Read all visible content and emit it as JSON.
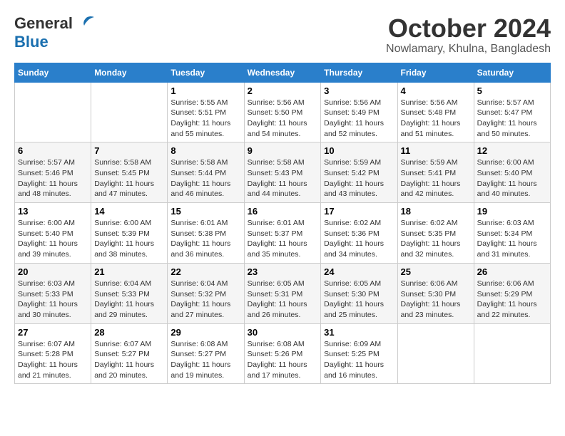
{
  "header": {
    "logo_line1": "General",
    "logo_line2": "Blue",
    "month": "October 2024",
    "location": "Nowlamary, Khulna, Bangladesh"
  },
  "weekdays": [
    "Sunday",
    "Monday",
    "Tuesday",
    "Wednesday",
    "Thursday",
    "Friday",
    "Saturday"
  ],
  "weeks": [
    [
      {
        "day": "",
        "sunrise": "",
        "sunset": "",
        "daylight": ""
      },
      {
        "day": "",
        "sunrise": "",
        "sunset": "",
        "daylight": ""
      },
      {
        "day": "1",
        "sunrise": "Sunrise: 5:55 AM",
        "sunset": "Sunset: 5:51 PM",
        "daylight": "Daylight: 11 hours and 55 minutes."
      },
      {
        "day": "2",
        "sunrise": "Sunrise: 5:56 AM",
        "sunset": "Sunset: 5:50 PM",
        "daylight": "Daylight: 11 hours and 54 minutes."
      },
      {
        "day": "3",
        "sunrise": "Sunrise: 5:56 AM",
        "sunset": "Sunset: 5:49 PM",
        "daylight": "Daylight: 11 hours and 52 minutes."
      },
      {
        "day": "4",
        "sunrise": "Sunrise: 5:56 AM",
        "sunset": "Sunset: 5:48 PM",
        "daylight": "Daylight: 11 hours and 51 minutes."
      },
      {
        "day": "5",
        "sunrise": "Sunrise: 5:57 AM",
        "sunset": "Sunset: 5:47 PM",
        "daylight": "Daylight: 11 hours and 50 minutes."
      }
    ],
    [
      {
        "day": "6",
        "sunrise": "Sunrise: 5:57 AM",
        "sunset": "Sunset: 5:46 PM",
        "daylight": "Daylight: 11 hours and 48 minutes."
      },
      {
        "day": "7",
        "sunrise": "Sunrise: 5:58 AM",
        "sunset": "Sunset: 5:45 PM",
        "daylight": "Daylight: 11 hours and 47 minutes."
      },
      {
        "day": "8",
        "sunrise": "Sunrise: 5:58 AM",
        "sunset": "Sunset: 5:44 PM",
        "daylight": "Daylight: 11 hours and 46 minutes."
      },
      {
        "day": "9",
        "sunrise": "Sunrise: 5:58 AM",
        "sunset": "Sunset: 5:43 PM",
        "daylight": "Daylight: 11 hours and 44 minutes."
      },
      {
        "day": "10",
        "sunrise": "Sunrise: 5:59 AM",
        "sunset": "Sunset: 5:42 PM",
        "daylight": "Daylight: 11 hours and 43 minutes."
      },
      {
        "day": "11",
        "sunrise": "Sunrise: 5:59 AM",
        "sunset": "Sunset: 5:41 PM",
        "daylight": "Daylight: 11 hours and 42 minutes."
      },
      {
        "day": "12",
        "sunrise": "Sunrise: 6:00 AM",
        "sunset": "Sunset: 5:40 PM",
        "daylight": "Daylight: 11 hours and 40 minutes."
      }
    ],
    [
      {
        "day": "13",
        "sunrise": "Sunrise: 6:00 AM",
        "sunset": "Sunset: 5:40 PM",
        "daylight": "Daylight: 11 hours and 39 minutes."
      },
      {
        "day": "14",
        "sunrise": "Sunrise: 6:00 AM",
        "sunset": "Sunset: 5:39 PM",
        "daylight": "Daylight: 11 hours and 38 minutes."
      },
      {
        "day": "15",
        "sunrise": "Sunrise: 6:01 AM",
        "sunset": "Sunset: 5:38 PM",
        "daylight": "Daylight: 11 hours and 36 minutes."
      },
      {
        "day": "16",
        "sunrise": "Sunrise: 6:01 AM",
        "sunset": "Sunset: 5:37 PM",
        "daylight": "Daylight: 11 hours and 35 minutes."
      },
      {
        "day": "17",
        "sunrise": "Sunrise: 6:02 AM",
        "sunset": "Sunset: 5:36 PM",
        "daylight": "Daylight: 11 hours and 34 minutes."
      },
      {
        "day": "18",
        "sunrise": "Sunrise: 6:02 AM",
        "sunset": "Sunset: 5:35 PM",
        "daylight": "Daylight: 11 hours and 32 minutes."
      },
      {
        "day": "19",
        "sunrise": "Sunrise: 6:03 AM",
        "sunset": "Sunset: 5:34 PM",
        "daylight": "Daylight: 11 hours and 31 minutes."
      }
    ],
    [
      {
        "day": "20",
        "sunrise": "Sunrise: 6:03 AM",
        "sunset": "Sunset: 5:33 PM",
        "daylight": "Daylight: 11 hours and 30 minutes."
      },
      {
        "day": "21",
        "sunrise": "Sunrise: 6:04 AM",
        "sunset": "Sunset: 5:33 PM",
        "daylight": "Daylight: 11 hours and 29 minutes."
      },
      {
        "day": "22",
        "sunrise": "Sunrise: 6:04 AM",
        "sunset": "Sunset: 5:32 PM",
        "daylight": "Daylight: 11 hours and 27 minutes."
      },
      {
        "day": "23",
        "sunrise": "Sunrise: 6:05 AM",
        "sunset": "Sunset: 5:31 PM",
        "daylight": "Daylight: 11 hours and 26 minutes."
      },
      {
        "day": "24",
        "sunrise": "Sunrise: 6:05 AM",
        "sunset": "Sunset: 5:30 PM",
        "daylight": "Daylight: 11 hours and 25 minutes."
      },
      {
        "day": "25",
        "sunrise": "Sunrise: 6:06 AM",
        "sunset": "Sunset: 5:30 PM",
        "daylight": "Daylight: 11 hours and 23 minutes."
      },
      {
        "day": "26",
        "sunrise": "Sunrise: 6:06 AM",
        "sunset": "Sunset: 5:29 PM",
        "daylight": "Daylight: 11 hours and 22 minutes."
      }
    ],
    [
      {
        "day": "27",
        "sunrise": "Sunrise: 6:07 AM",
        "sunset": "Sunset: 5:28 PM",
        "daylight": "Daylight: 11 hours and 21 minutes."
      },
      {
        "day": "28",
        "sunrise": "Sunrise: 6:07 AM",
        "sunset": "Sunset: 5:27 PM",
        "daylight": "Daylight: 11 hours and 20 minutes."
      },
      {
        "day": "29",
        "sunrise": "Sunrise: 6:08 AM",
        "sunset": "Sunset: 5:27 PM",
        "daylight": "Daylight: 11 hours and 19 minutes."
      },
      {
        "day": "30",
        "sunrise": "Sunrise: 6:08 AM",
        "sunset": "Sunset: 5:26 PM",
        "daylight": "Daylight: 11 hours and 17 minutes."
      },
      {
        "day": "31",
        "sunrise": "Sunrise: 6:09 AM",
        "sunset": "Sunset: 5:25 PM",
        "daylight": "Daylight: 11 hours and 16 minutes."
      },
      {
        "day": "",
        "sunrise": "",
        "sunset": "",
        "daylight": ""
      },
      {
        "day": "",
        "sunrise": "",
        "sunset": "",
        "daylight": ""
      }
    ]
  ]
}
